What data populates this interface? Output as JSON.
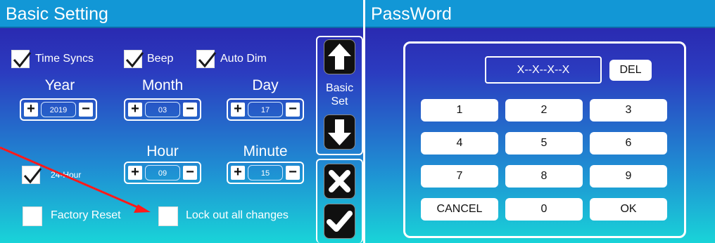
{
  "basic": {
    "title": "Basic Setting",
    "checks": {
      "time_syncs": {
        "label": "Time Syncs",
        "checked": true
      },
      "beep": {
        "label": "Beep",
        "checked": true
      },
      "auto_dim": {
        "label": "Auto Dim",
        "checked": true
      },
      "hour24": {
        "label": "24-Hour",
        "checked": true
      },
      "factory_reset": {
        "label": "Factory Reset",
        "checked": false
      },
      "lock_out": {
        "label": "Lock out all changes",
        "checked": false
      }
    },
    "year": {
      "label": "Year",
      "value": "2019"
    },
    "month": {
      "label": "Month",
      "value": "03"
    },
    "day": {
      "label": "Day",
      "value": "17"
    },
    "hour": {
      "label": "Hour",
      "value": "09"
    },
    "minute": {
      "label": "Minute",
      "value": "15"
    },
    "plus": "+",
    "minus": "−",
    "nav_label_1": "Basic",
    "nav_label_2": "Set"
  },
  "password": {
    "title": "PassWord",
    "display": "X--X--X--X",
    "del": "DEL",
    "keys": [
      "1",
      "2",
      "3",
      "4",
      "5",
      "6",
      "7",
      "8",
      "9",
      "CANCEL",
      "0",
      "OK"
    ]
  },
  "colors": {
    "title_bar": "#1297d6",
    "arrow": "#ff1a1a"
  }
}
